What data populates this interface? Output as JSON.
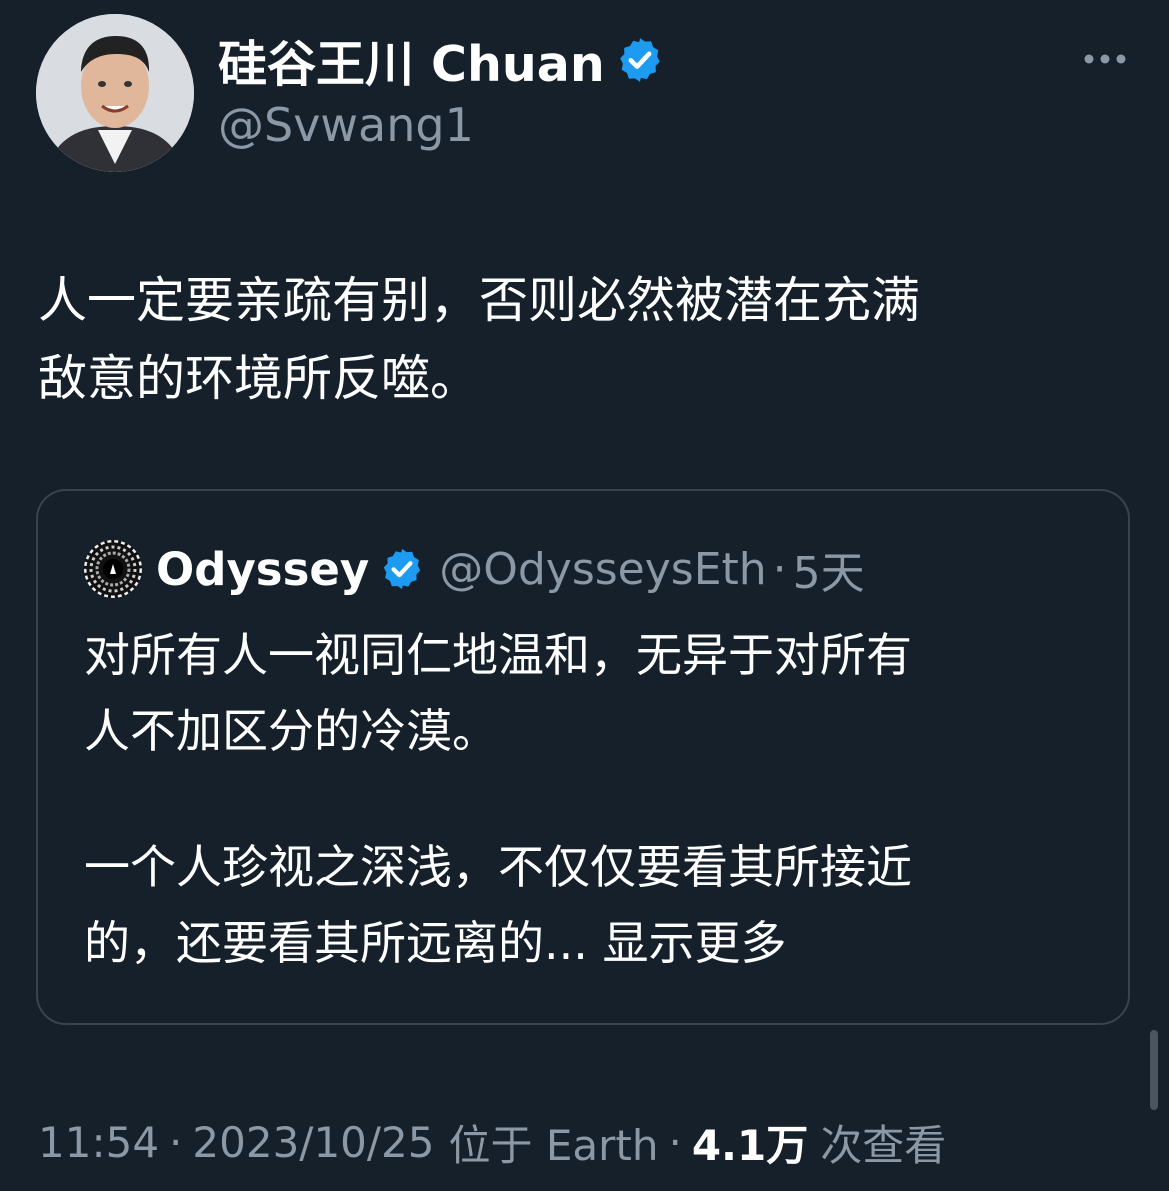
{
  "author": {
    "display_name": "硅谷王川 Chuan",
    "handle": "@Svwang1",
    "avatar_icon": "profile-photo",
    "verified_icon": "verified-badge-icon"
  },
  "menu": {
    "more_icon": "more-horizontal-icon"
  },
  "tweet": {
    "text_lines": [
      "人一定要亲疏有别，否则必然被潜在充满",
      "敌意的环境所反噬。"
    ]
  },
  "quoted_tweet": {
    "display_name": "Odyssey",
    "handle": "@OdysseysEth",
    "separator": "·",
    "time": "5天",
    "text_lines": [
      "对所有人一视同仁地温和，无异于对所有",
      "人不加区分的冷漠。"
    ],
    "text_lines_2": [
      "一个人珍视之深浅，不仅仅要看其所接近",
      "的，还要看其所远离的..."
    ],
    "show_more": "显示更多"
  },
  "meta": {
    "time": "11:54",
    "sep1": "·",
    "date": "2023/10/25",
    "location": "位于 Earth",
    "sep2": "·",
    "views_count": "4.1万",
    "views_label": "次查看"
  },
  "colors": {
    "background": "#15202b",
    "verified_blue": "#1d9bf0",
    "secondary_text": "#8b98a5",
    "border": "#38444d"
  }
}
